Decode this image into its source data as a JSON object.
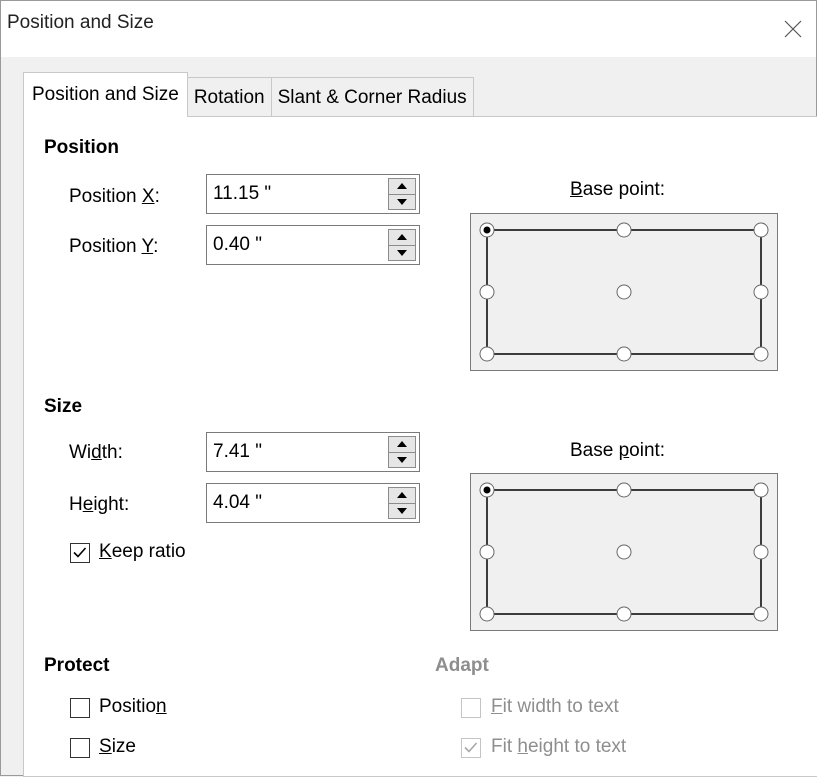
{
  "window": {
    "title": "Position and Size"
  },
  "tabs": [
    {
      "label": "Position and Size",
      "active": true
    },
    {
      "label": "Rotation",
      "active": false
    },
    {
      "label": "Slant & Corner Radius",
      "active": false
    }
  ],
  "position": {
    "title": "Position",
    "x": {
      "label_pre": "Position ",
      "label_key": "X",
      "label_post": ":",
      "value": "11.15 \""
    },
    "y": {
      "label_pre": "Position ",
      "label_key": "Y",
      "label_post": ":",
      "value": "0.40 \""
    },
    "base_point": {
      "label_key": "B",
      "label_post": "ase point:",
      "selected": "top-left"
    }
  },
  "size": {
    "title": "Size",
    "width": {
      "label_pre": "Wi",
      "label_key": "d",
      "label_post": "th:",
      "value": "7.41 \""
    },
    "height": {
      "label_pre": "H",
      "label_key": "e",
      "label_post": "ight:",
      "value": "4.04 \""
    },
    "keep_ratio": {
      "label_key": "K",
      "label_post": "eep ratio",
      "checked": true
    },
    "base_point": {
      "label_pre": "Base ",
      "label_key": "p",
      "label_post": "oint:",
      "selected": "top-left"
    }
  },
  "protect": {
    "title": "Protect",
    "position": {
      "label_pre": "Positio",
      "label_key": "n",
      "checked": false
    },
    "size": {
      "label_key": "S",
      "label_post": "ize",
      "checked": false
    }
  },
  "adapt": {
    "title": "Adapt",
    "fit_width": {
      "label_key": "F",
      "label_post": "it width to text",
      "checked": false,
      "enabled": false
    },
    "fit_height": {
      "label_pre": "Fit ",
      "label_key": "h",
      "label_post": "eight to text",
      "checked": true,
      "enabled": false
    }
  },
  "icons": {
    "close": "close-icon",
    "spin_up": "triangle-up-icon",
    "spin_down": "triangle-down-icon",
    "check": "checkmark-icon",
    "radio": "radio-icon"
  },
  "colors": {
    "panel_bg": "#ffffff",
    "window_bg": "#f0f0f0",
    "disabled_text": "#8e8e8e"
  }
}
